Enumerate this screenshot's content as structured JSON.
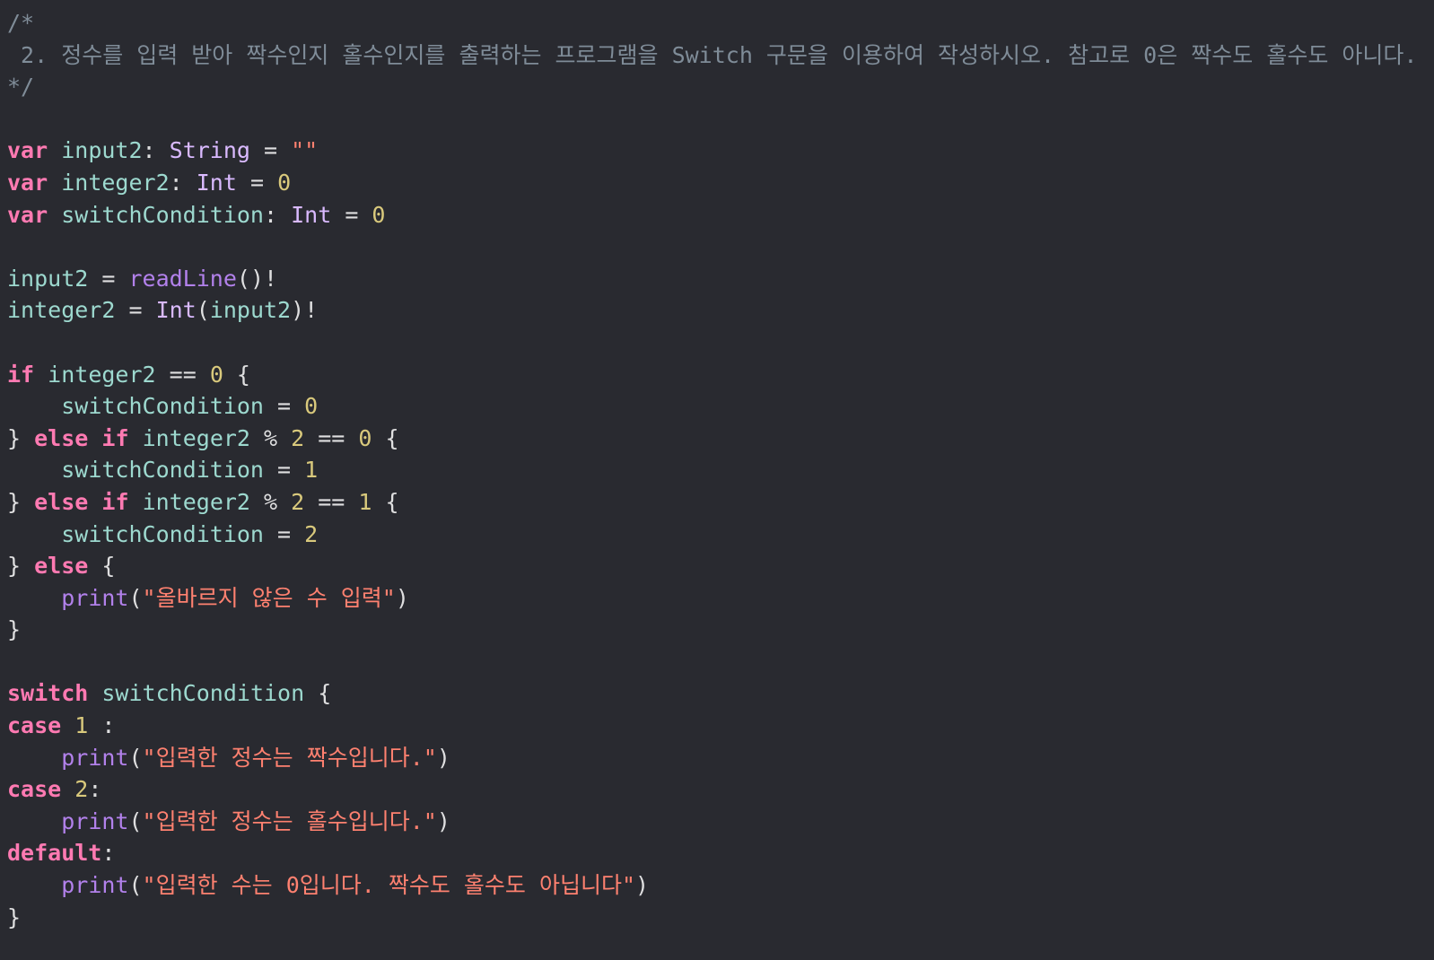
{
  "colors": {
    "background": "#292a30",
    "comment": "#7f8c98",
    "keyword": "#ff7ab2",
    "type": "#dabaff",
    "identifier": "#9dd9cf",
    "function": "#b281eb",
    "number": "#d9c97c",
    "string": "#ff8170",
    "plain": "#dfdfe0"
  },
  "code": {
    "lines": [
      [
        {
          "t": "/*",
          "c": "comment"
        }
      ],
      [
        {
          "t": " 2. 정수를 입력 받아 짝수인지 홀수인지를 출력하는 프로그램을 Switch 구문을 이용하여 작성하시오. 참고로 0은 짝수도 홀수도 아니다.",
          "c": "comment"
        }
      ],
      [
        {
          "t": "*/",
          "c": "comment"
        }
      ],
      [],
      [
        {
          "t": "var",
          "c": "kw"
        },
        {
          "t": " ",
          "c": "plain"
        },
        {
          "t": "input2",
          "c": "ident"
        },
        {
          "t": ": ",
          "c": "plain"
        },
        {
          "t": "String",
          "c": "type"
        },
        {
          "t": " = ",
          "c": "plain"
        },
        {
          "t": "\"\"",
          "c": "str"
        }
      ],
      [
        {
          "t": "var",
          "c": "kw"
        },
        {
          "t": " ",
          "c": "plain"
        },
        {
          "t": "integer2",
          "c": "ident"
        },
        {
          "t": ": ",
          "c": "plain"
        },
        {
          "t": "Int",
          "c": "type"
        },
        {
          "t": " = ",
          "c": "plain"
        },
        {
          "t": "0",
          "c": "num"
        }
      ],
      [
        {
          "t": "var",
          "c": "kw"
        },
        {
          "t": " ",
          "c": "plain"
        },
        {
          "t": "switchCondition",
          "c": "ident"
        },
        {
          "t": ": ",
          "c": "plain"
        },
        {
          "t": "Int",
          "c": "type"
        },
        {
          "t": " = ",
          "c": "plain"
        },
        {
          "t": "0",
          "c": "num"
        }
      ],
      [],
      [
        {
          "t": "input2",
          "c": "ident"
        },
        {
          "t": " = ",
          "c": "plain"
        },
        {
          "t": "readLine",
          "c": "func"
        },
        {
          "t": "()!",
          "c": "plain"
        }
      ],
      [
        {
          "t": "integer2",
          "c": "ident"
        },
        {
          "t": " = ",
          "c": "plain"
        },
        {
          "t": "Int",
          "c": "type"
        },
        {
          "t": "(",
          "c": "plain"
        },
        {
          "t": "input2",
          "c": "ident"
        },
        {
          "t": ")!",
          "c": "plain"
        }
      ],
      [],
      [
        {
          "t": "if",
          "c": "kw"
        },
        {
          "t": " ",
          "c": "plain"
        },
        {
          "t": "integer2",
          "c": "ident"
        },
        {
          "t": " == ",
          "c": "plain"
        },
        {
          "t": "0",
          "c": "num"
        },
        {
          "t": " {",
          "c": "plain"
        }
      ],
      [
        {
          "t": "    ",
          "c": "plain"
        },
        {
          "t": "switchCondition",
          "c": "ident"
        },
        {
          "t": " = ",
          "c": "plain"
        },
        {
          "t": "0",
          "c": "num"
        }
      ],
      [
        {
          "t": "} ",
          "c": "plain"
        },
        {
          "t": "else",
          "c": "kw"
        },
        {
          "t": " ",
          "c": "plain"
        },
        {
          "t": "if",
          "c": "kw"
        },
        {
          "t": " ",
          "c": "plain"
        },
        {
          "t": "integer2",
          "c": "ident"
        },
        {
          "t": " % ",
          "c": "plain"
        },
        {
          "t": "2",
          "c": "num"
        },
        {
          "t": " == ",
          "c": "plain"
        },
        {
          "t": "0",
          "c": "num"
        },
        {
          "t": " {",
          "c": "plain"
        }
      ],
      [
        {
          "t": "    ",
          "c": "plain"
        },
        {
          "t": "switchCondition",
          "c": "ident"
        },
        {
          "t": " = ",
          "c": "plain"
        },
        {
          "t": "1",
          "c": "num"
        }
      ],
      [
        {
          "t": "} ",
          "c": "plain"
        },
        {
          "t": "else",
          "c": "kw"
        },
        {
          "t": " ",
          "c": "plain"
        },
        {
          "t": "if",
          "c": "kw"
        },
        {
          "t": " ",
          "c": "plain"
        },
        {
          "t": "integer2",
          "c": "ident"
        },
        {
          "t": " % ",
          "c": "plain"
        },
        {
          "t": "2",
          "c": "num"
        },
        {
          "t": " == ",
          "c": "plain"
        },
        {
          "t": "1",
          "c": "num"
        },
        {
          "t": " {",
          "c": "plain"
        }
      ],
      [
        {
          "t": "    ",
          "c": "plain"
        },
        {
          "t": "switchCondition",
          "c": "ident"
        },
        {
          "t": " = ",
          "c": "plain"
        },
        {
          "t": "2",
          "c": "num"
        }
      ],
      [
        {
          "t": "} ",
          "c": "plain"
        },
        {
          "t": "else",
          "c": "kw"
        },
        {
          "t": " {",
          "c": "plain"
        }
      ],
      [
        {
          "t": "    ",
          "c": "plain"
        },
        {
          "t": "print",
          "c": "func"
        },
        {
          "t": "(",
          "c": "plain"
        },
        {
          "t": "\"올바르지 않은 수 입력\"",
          "c": "str"
        },
        {
          "t": ")",
          "c": "plain"
        }
      ],
      [
        {
          "t": "}",
          "c": "plain"
        }
      ],
      [],
      [
        {
          "t": "switch",
          "c": "kw"
        },
        {
          "t": " ",
          "c": "plain"
        },
        {
          "t": "switchCondition",
          "c": "ident"
        },
        {
          "t": " {",
          "c": "plain"
        }
      ],
      [
        {
          "t": "case",
          "c": "kw"
        },
        {
          "t": " ",
          "c": "plain"
        },
        {
          "t": "1",
          "c": "num"
        },
        {
          "t": " :",
          "c": "plain"
        }
      ],
      [
        {
          "t": "    ",
          "c": "plain"
        },
        {
          "t": "print",
          "c": "func"
        },
        {
          "t": "(",
          "c": "plain"
        },
        {
          "t": "\"입력한 정수는 짝수입니다.\"",
          "c": "str"
        },
        {
          "t": ")",
          "c": "plain"
        }
      ],
      [
        {
          "t": "case",
          "c": "kw"
        },
        {
          "t": " ",
          "c": "plain"
        },
        {
          "t": "2",
          "c": "num"
        },
        {
          "t": ":",
          "c": "plain"
        }
      ],
      [
        {
          "t": "    ",
          "c": "plain"
        },
        {
          "t": "print",
          "c": "func"
        },
        {
          "t": "(",
          "c": "plain"
        },
        {
          "t": "\"입력한 정수는 홀수입니다.\"",
          "c": "str"
        },
        {
          "t": ")",
          "c": "plain"
        }
      ],
      [
        {
          "t": "default",
          "c": "kw"
        },
        {
          "t": ":",
          "c": "plain"
        }
      ],
      [
        {
          "t": "    ",
          "c": "plain"
        },
        {
          "t": "print",
          "c": "func"
        },
        {
          "t": "(",
          "c": "plain"
        },
        {
          "t": "\"입력한 수는 0입니다. 짝수도 홀수도 아닙니다\"",
          "c": "str"
        },
        {
          "t": ")",
          "c": "plain"
        }
      ],
      [
        {
          "t": "}",
          "c": "plain"
        }
      ]
    ]
  }
}
